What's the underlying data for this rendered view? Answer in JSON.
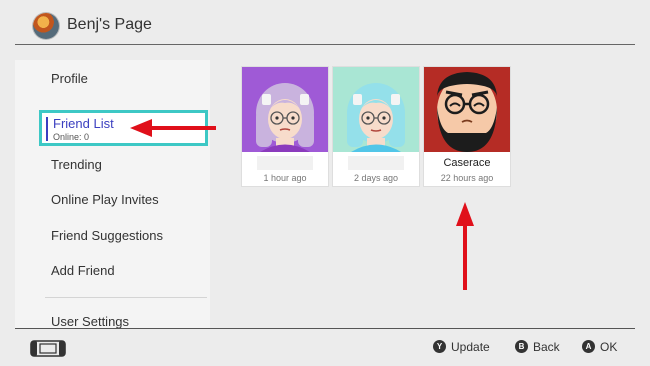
{
  "header": {
    "title": "Benj's Page"
  },
  "sidebar": {
    "items": [
      {
        "label": "Profile"
      },
      {
        "label": "Friend List",
        "sublabel": "Online: 0"
      },
      {
        "label": "Trending"
      },
      {
        "label": "Online Play Invites"
      },
      {
        "label": "Friend Suggestions"
      },
      {
        "label": "Add Friend"
      },
      {
        "label": "User Settings"
      }
    ]
  },
  "friends": [
    {
      "name": "",
      "last_online": "1 hour ago"
    },
    {
      "name": "",
      "last_online": "2 days ago"
    },
    {
      "name": "Caserace",
      "last_online": "22 hours ago"
    }
  ],
  "footer": {
    "update": {
      "key": "Y",
      "label": "Update"
    },
    "back": {
      "key": "B",
      "label": "Back"
    },
    "ok": {
      "key": "A",
      "label": "OK"
    }
  },
  "colors": {
    "selection_border": "#3dc8c5",
    "selection_text": "#3b3fc0",
    "annotation_arrow": "#e0101a"
  }
}
